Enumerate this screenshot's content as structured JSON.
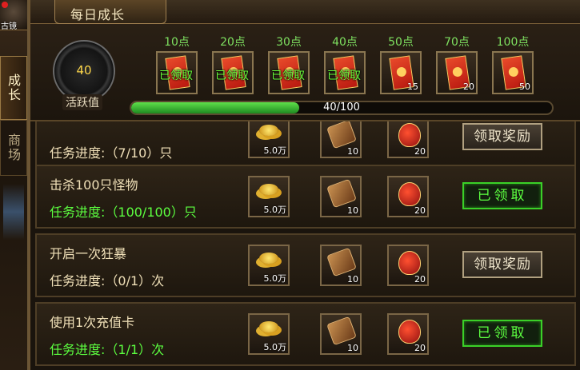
{
  "sidebar": {
    "avatar_label": "古镜",
    "tabs": [
      {
        "label": "成长",
        "active": true
      },
      {
        "label": "商场",
        "active": false
      }
    ]
  },
  "title": "每日成长",
  "activity": {
    "value": "40",
    "label": "活跃值"
  },
  "milestones": [
    {
      "points": "10点",
      "status": "已领取",
      "count": ""
    },
    {
      "points": "20点",
      "status": "已领取",
      "count": ""
    },
    {
      "points": "30点",
      "status": "已领取",
      "count": ""
    },
    {
      "points": "40点",
      "status": "已领取",
      "count": ""
    },
    {
      "points": "50点",
      "status": "",
      "count": "15"
    },
    {
      "points": "70点",
      "status": "",
      "count": "20"
    },
    {
      "points": "100点",
      "status": "",
      "count": "50"
    }
  ],
  "progress": {
    "text": "40/100",
    "fraction": 0.4
  },
  "colors": {
    "claimed_green": "#5cff40",
    "progress_green": "#3cc030",
    "gold_text": "#ffd84a"
  },
  "rewards": {
    "gold": "5.0万",
    "scroll_count": "10",
    "bag_count": "20"
  },
  "tasks": [
    {
      "name": "",
      "progress": "任务进度:（7/10）只",
      "state": "claim",
      "button": "领取奖励"
    },
    {
      "name": "击杀100只怪物",
      "progress": "任务进度:（100/100）只",
      "state": "done",
      "button": "已领取"
    },
    {
      "name": "开启一次狂暴",
      "progress": "任务进度:（0/1）次",
      "state": "claim",
      "button": "领取奖励"
    },
    {
      "name": "使用1次充值卡",
      "progress": "任务进度:（1/1）次",
      "state": "done",
      "button": "已领取"
    }
  ]
}
